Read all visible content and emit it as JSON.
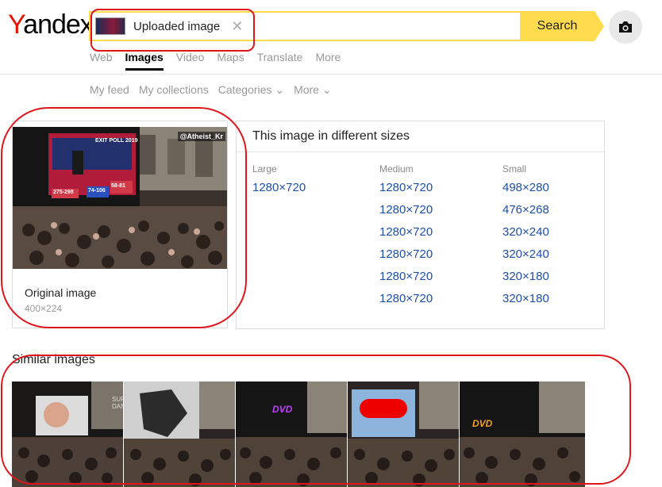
{
  "logo": "Yandex",
  "search": {
    "chip_label": "Uploaded image",
    "button_label": "Search",
    "camera_icon": "camera-icon"
  },
  "tabs": [
    {
      "label": "Web"
    },
    {
      "label": "Images",
      "active": true
    },
    {
      "label": "Video"
    },
    {
      "label": "Maps"
    },
    {
      "label": "Translate"
    },
    {
      "label": "More"
    }
  ],
  "subnav": {
    "my_feed": "My feed",
    "my_collections": "My collections",
    "categories": "Categories",
    "more": "More"
  },
  "original": {
    "label": "Original image",
    "size": "400×224",
    "watermark": "@Atheist_Kr",
    "screen_text": "EXIT POLL 2019",
    "scores": [
      "275-298",
      "74-106",
      "58-81"
    ]
  },
  "sizes": {
    "title": "This image in different sizes",
    "large": {
      "heading": "Large",
      "items": [
        "1280×720"
      ]
    },
    "medium": {
      "heading": "Medium",
      "items": [
        "1280×720",
        "1280×720",
        "1280×720",
        "1280×720",
        "1280×720",
        "1280×720"
      ]
    },
    "small": {
      "heading": "Small",
      "items": [
        "498×280",
        "476×268",
        "320×240",
        "320×240",
        "320×180",
        "320×180"
      ]
    }
  },
  "similar": {
    "title": "Similar images",
    "thumb_texts": [
      "SUPPA DAN",
      "",
      "DVD",
      "",
      "DVD"
    ]
  },
  "colors": {
    "accent_yellow": "#ffdb4d",
    "logo_red": "#e61400",
    "link_blue": "#1f4ea8",
    "annotation_red": "#e0151b"
  }
}
